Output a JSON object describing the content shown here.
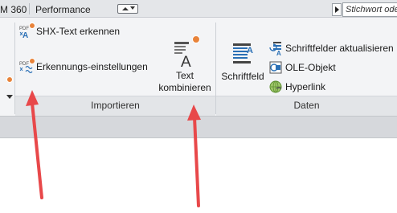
{
  "tabs": {
    "partial_tab": "M 360",
    "performance": "Performance"
  },
  "search": {
    "placeholder": "Stichwort ode"
  },
  "panels": {
    "importieren": {
      "title": "Importieren",
      "shx_text": "SHX-Text erkennen",
      "erkennungs": "Erkennungs-einstellungen",
      "text_kombinieren_line1": "Text",
      "text_kombinieren_line2": "kombinieren"
    },
    "daten": {
      "title": "Daten",
      "schriftfeld": "Schriftfeld",
      "schriftfelder_aktualisieren": "Schriftfelder aktualisieren",
      "ole_objekt": "OLE-Objekt",
      "hyperlink": "Hyperlink"
    }
  },
  "icons": {
    "shx": "pdf-shx-icon",
    "erkennung": "pdf-settings-icon",
    "text_kombinieren": "text-combine-icon",
    "schriftfeld": "field-icon",
    "aktualisieren": "update-fields-icon",
    "ole": "ole-object-icon",
    "hyperlink": "hyperlink-icon"
  },
  "colors": {
    "badge": "#e8833a",
    "annotation_arrow": "#e8484a"
  }
}
